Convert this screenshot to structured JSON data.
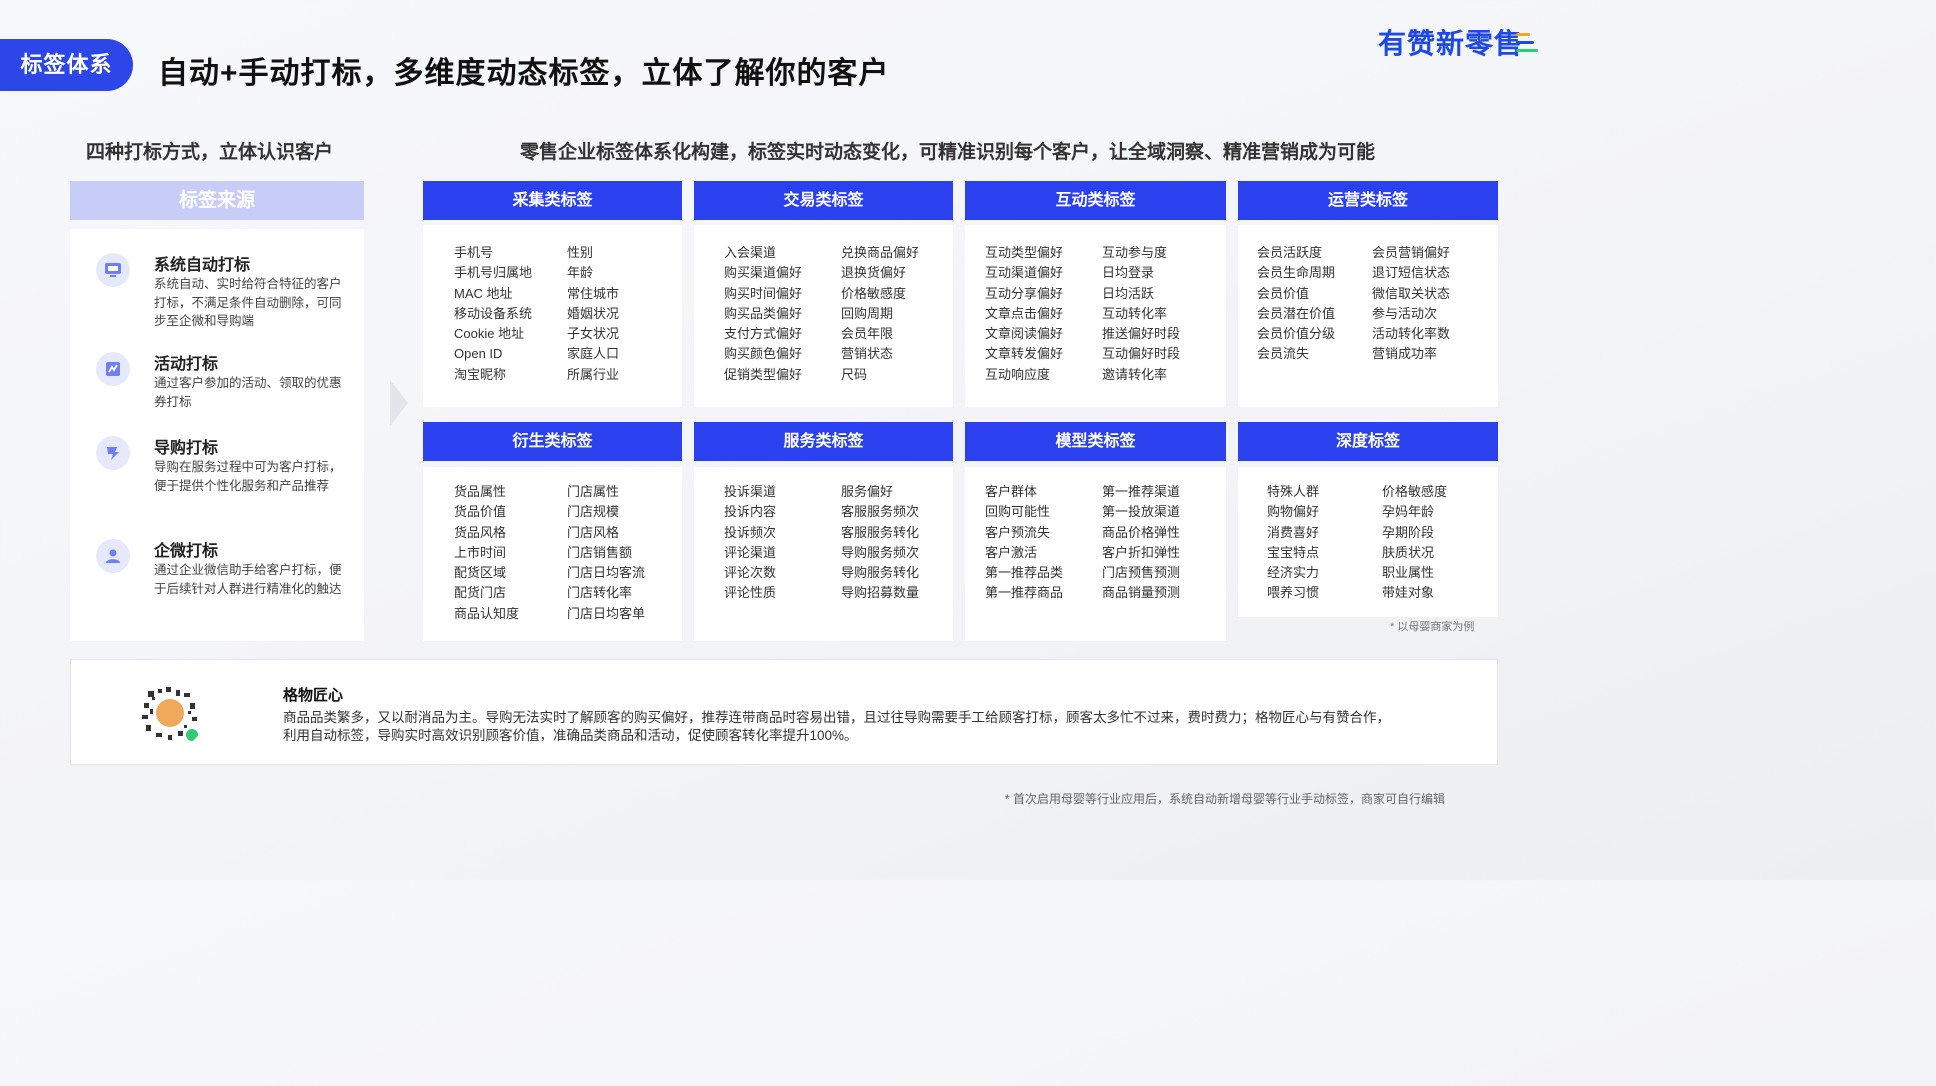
{
  "header": {
    "badge": "标签体系",
    "title": "自动+手动打标，多维度动态标签，立体了解你的客户",
    "brand": "有赞新零售",
    "brand_colors": [
      "#f5a623",
      "#1f49e6",
      "#2ecc71"
    ]
  },
  "left": {
    "subtitle": "四种打标方式，立体认识客户",
    "panel_title": "标签来源",
    "items": [
      {
        "title": "系统自动打标",
        "desc": "系统自动、实时给符合特征的客户打标，不满足条件自动删除，可同步至企微和导购端",
        "icon": "monitor-icon"
      },
      {
        "title": "活动打标",
        "desc": "通过客户参加的活动、领取的优惠券打标",
        "icon": "activity-icon"
      },
      {
        "title": "导购打标",
        "desc": "导购在服务过程中可为客户打标，便于提供个性化服务和产品推荐",
        "icon": "guide-icon"
      },
      {
        "title": "企微打标",
        "desc": "通过企业微信助手给客户打标，便于后续针对人群进行精准化的触达",
        "icon": "user-icon"
      }
    ]
  },
  "right": {
    "subtitle": "零售企业标签体系化构建，标签实时动态变化，可精准识别每个客户，让全域洞察、精准营销成为可能",
    "categories": [
      {
        "title": "采集类标签",
        "col1": [
          "手机号",
          "手机号归属地",
          "MAC 地址",
          "移动设备系统",
          "Cookie 地址",
          "Open ID",
          "淘宝昵称"
        ],
        "col2": [
          "性别",
          "年龄",
          "常住城市",
          "婚姻状况",
          "子女状况",
          "家庭人口",
          "所属行业"
        ]
      },
      {
        "title": "交易类标签",
        "col1": [
          "入会渠道",
          "购买渠道偏好",
          "购买时间偏好",
          "购买品类偏好",
          "支付方式偏好",
          "购买颜色偏好",
          "促销类型偏好"
        ],
        "col2": [
          "兑换商品偏好",
          "退换货偏好",
          "价格敏感度",
          "回购周期",
          "会员年限",
          "营销状态",
          "尺码"
        ]
      },
      {
        "title": "互动类标签",
        "col1": [
          "互动类型偏好",
          "互动渠道偏好",
          "互动分享偏好",
          "文章点击偏好",
          "文章阅读偏好",
          "文章转发偏好",
          "互动响应度"
        ],
        "col2": [
          "互动参与度",
          "日均登录",
          "日均活跃",
          "互动转化率",
          "推送偏好时段",
          "互动偏好时段",
          "邀请转化率"
        ]
      },
      {
        "title": "运营类标签",
        "col1": [
          "会员活跃度",
          "会员生命周期",
          "会员价值",
          "会员潜在价值",
          "会员价值分级",
          "会员流失"
        ],
        "col2": [
          "会员营销偏好",
          "退订短信状态",
          "微信取关状态",
          "参与活动次",
          "活动转化率数",
          "营销成功率"
        ]
      },
      {
        "title": "衍生类标签",
        "col1": [
          "货品属性",
          "货品价值",
          "货品风格",
          "上市时间",
          "配货区域",
          "配货门店",
          "商品认知度"
        ],
        "col2": [
          "门店属性",
          "门店规模",
          "门店风格",
          "门店销售额",
          "门店日均客流",
          "门店转化率",
          "门店日均客单"
        ]
      },
      {
        "title": "服务类标签",
        "col1": [
          "投诉渠道",
          "投诉内容",
          "投诉频次",
          "评论渠道",
          "评论次数",
          "评论性质"
        ],
        "col2": [
          "服务偏好",
          "客服服务频次",
          "客服服务转化",
          "导购服务频次",
          "导购服务转化",
          "导购招募数量"
        ]
      },
      {
        "title": "模型类标签",
        "col1": [
          "客户群体",
          "回购可能性",
          "客户预流失",
          "客户激活",
          "第一推荐品类",
          "第一推荐商品"
        ],
        "col2": [
          "第一推荐渠道",
          "第一投放渠道",
          "商品价格弹性",
          "客户折扣弹性",
          "门店预售预测",
          "商品销量预测"
        ]
      },
      {
        "title": "深度标签",
        "col1": [
          "特殊人群",
          "购物偏好",
          "消费喜好",
          "宝宝特点",
          "经济实力",
          "喂养习惯"
        ],
        "col2": [
          "价格敏感度",
          "孕妈年龄",
          "孕期阶段",
          "肤质状况",
          "职业属性",
          "带娃对象"
        ]
      }
    ],
    "note": "* 以母婴商家为例"
  },
  "case": {
    "title": "格物匠心",
    "body": "商品品类繁多，又以耐消品为主。导购无法实时了解顾客的购买偏好，推荐连带商品时容易出错，且过往导购需要手工给顾客打标，顾客太多忙不过来，费时费力；格物匠心与有赞合作，利用自动标签，导购实时高效识别顾客价值，准确品类商品和活动，促使顾客转化率提升100%。"
  },
  "footer": "* 首次启用母婴等行业应用后，系统自动新增母婴等行业手动标签，商家可自行编辑"
}
